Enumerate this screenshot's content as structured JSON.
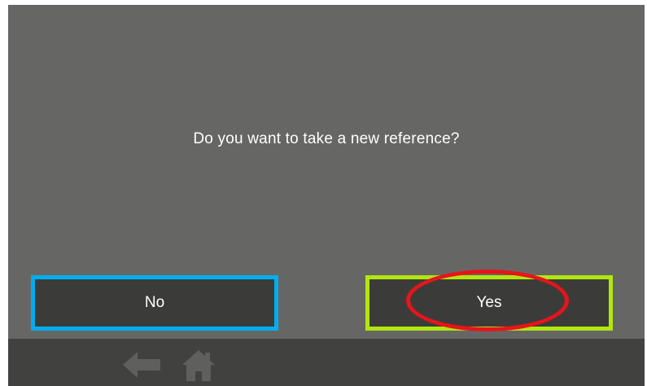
{
  "dialog": {
    "question": "Do you want to take a new reference?"
  },
  "buttons": {
    "no_label": "No",
    "yes_label": "Yes",
    "no_border_color": "#00aeef",
    "yes_border_color": "#b2e60f"
  },
  "annotation": {
    "highlight_color": "#e8141b"
  },
  "navbar": {
    "back_icon": "back-arrow-icon",
    "home_icon": "home-icon",
    "icon_color": "#5f605d"
  }
}
